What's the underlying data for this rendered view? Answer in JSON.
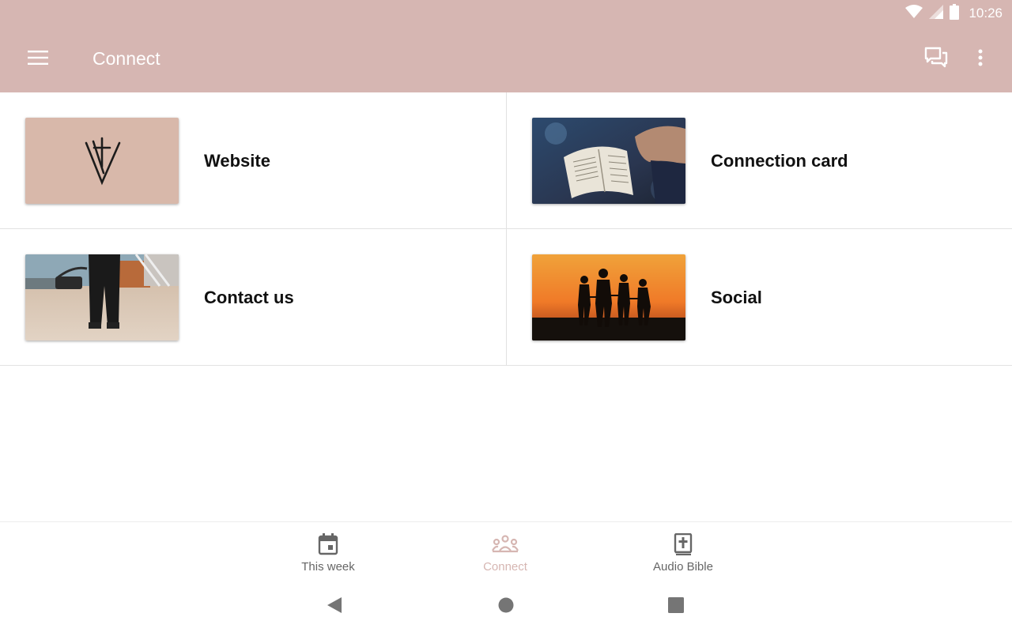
{
  "status_bar": {
    "time": "10:26",
    "icons": [
      "wifi-icon",
      "signal-icon",
      "battery-icon"
    ]
  },
  "app_bar": {
    "title": "Connect",
    "icons": [
      "menu-icon",
      "chat-icon",
      "more-vert-icon"
    ],
    "color": "#d6b6b2"
  },
  "cards": [
    {
      "label": "Website",
      "image": "logo-thumbnail"
    },
    {
      "label": "Connection card",
      "image": "bible-reading-photo"
    },
    {
      "label": "Contact us",
      "image": "person-walking-photo"
    },
    {
      "label": "Social",
      "image": "sunset-silhouettes-photo"
    }
  ],
  "bottom_nav": {
    "items": [
      {
        "label": "This week",
        "icon": "calendar-icon",
        "active": false
      },
      {
        "label": "Connect",
        "icon": "people-icon",
        "active": true
      },
      {
        "label": "Audio Bible",
        "icon": "bible-icon",
        "active": false
      }
    ],
    "active_color": "#d6b6b2"
  },
  "system_nav": {
    "icons": [
      "back-icon",
      "home-icon",
      "recents-icon"
    ]
  }
}
